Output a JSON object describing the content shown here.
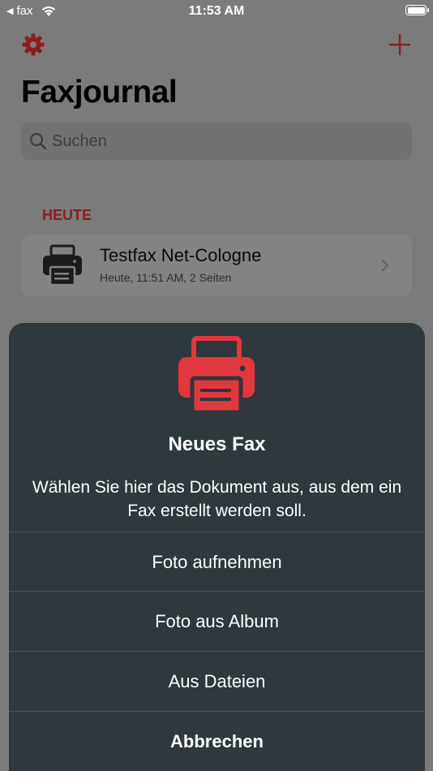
{
  "status_bar": {
    "back_label": "fax",
    "time": "11:53 AM"
  },
  "header": {
    "title": "Faxjournal",
    "icons": [
      "gear-icon",
      "plus-icon"
    ],
    "accent_color": "#8d1d1d"
  },
  "search": {
    "placeholder": "Suchen"
  },
  "journal": {
    "section_header": "HEUTE",
    "items": [
      {
        "title": "Testfax Net-Cologne",
        "subtitle": "Heute, 11:51 AM, 2 Seiten",
        "icon": "printer-icon"
      }
    ]
  },
  "action_sheet": {
    "icon": "printer-icon",
    "icon_color": "#e0383e",
    "title": "Neues Fax",
    "message": "Wählen Sie hier das Dokument aus, aus dem ein Fax erstellt werden soll.",
    "actions": [
      {
        "label": "Foto aufnehmen"
      },
      {
        "label": "Foto aus Album"
      },
      {
        "label": "Aus Dateien"
      }
    ],
    "cancel_label": "Abbrechen",
    "background_color": "#2e383d"
  }
}
